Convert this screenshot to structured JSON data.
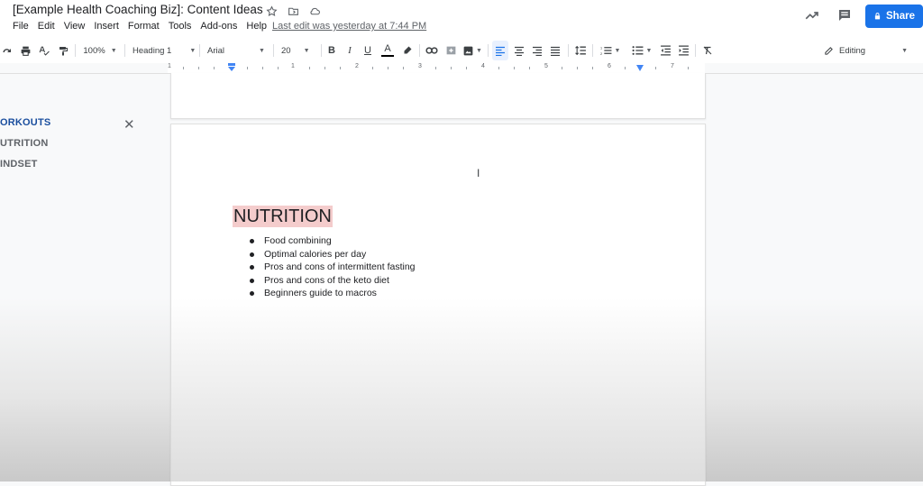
{
  "title": "[Example Health Coaching Biz]: Content Ideas",
  "last_edit": "Last edit was yesterday at 7:44 PM",
  "menu": [
    "File",
    "Edit",
    "View",
    "Insert",
    "Format",
    "Tools",
    "Add-ons",
    "Help"
  ],
  "share_label": "Share",
  "toolbar": {
    "zoom": "100%",
    "style": "Heading 1",
    "font": "Arial",
    "size": "20",
    "bold": "B",
    "italic": "I",
    "underline": "U",
    "text_color": "A",
    "mode": "Editing"
  },
  "ruler_numbers": [
    "1",
    "1",
    "2",
    "3",
    "4",
    "5",
    "6",
    "7"
  ],
  "outline": {
    "items": [
      "ORKOUTS",
      "UTRITION",
      "INDSET"
    ]
  },
  "document": {
    "heading": "NUTRITION",
    "bullets": [
      "Food combining",
      "Optimal calories per day",
      "Pros and cons of intermittent fasting",
      "Pros and cons of the keto diet",
      "Beginners guide to macros"
    ]
  },
  "colors": {
    "accent": "#1a73e8",
    "heading_highlight": "#f4cccc",
    "outline_active": "#1a4e9e"
  }
}
